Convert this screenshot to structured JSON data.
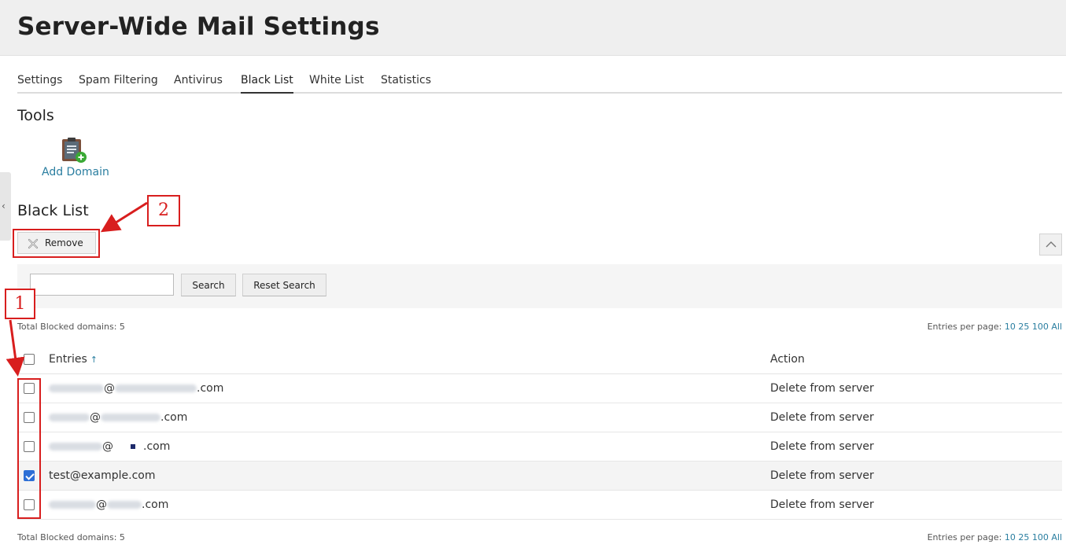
{
  "header": {
    "title": "Server-Wide Mail Settings"
  },
  "tabs": [
    {
      "label": "Settings",
      "active": false
    },
    {
      "label": "Spam Filtering",
      "active": false
    },
    {
      "label": "Antivirus",
      "active": false
    },
    {
      "label": "Black List",
      "active": true
    },
    {
      "label": "White List",
      "active": false
    },
    {
      "label": "Statistics",
      "active": false
    }
  ],
  "tools": {
    "title": "Tools",
    "add_domain_label": "Add Domain",
    "icon": "clipboard-add-icon"
  },
  "blacklist": {
    "title": "Black List",
    "remove_label": "Remove",
    "search_placeholder": "",
    "search_value": "",
    "search_label": "Search",
    "reset_label": "Reset Search",
    "total_text": "Total Blocked domains: 5",
    "entries_per_page_label": "Entries per page:",
    "page_sizes": [
      "10",
      "25",
      "100",
      "All"
    ],
    "columns": {
      "entries": "Entries",
      "action": "Action"
    },
    "rows": [
      {
        "domain": ".com",
        "at": "@",
        "action": "Delete from server",
        "checked": false
      },
      {
        "domain": ".com",
        "at": "@",
        "action": "Delete from server",
        "checked": false
      },
      {
        "domain": ".com",
        "at": "@",
        "action": "Delete from server",
        "checked": false
      },
      {
        "entry": "test@example.com",
        "action": "Delete from server",
        "checked": true
      },
      {
        "domain": ".com",
        "at": "@",
        "action": "Delete from server",
        "checked": false
      }
    ]
  },
  "annotations": {
    "step1": "1",
    "step2": "2",
    "color": "#d81e1e"
  },
  "colors": {
    "link": "#2a7ea0",
    "header_bg": "#efefef",
    "checkbox_checked": "#2d6fd6"
  }
}
